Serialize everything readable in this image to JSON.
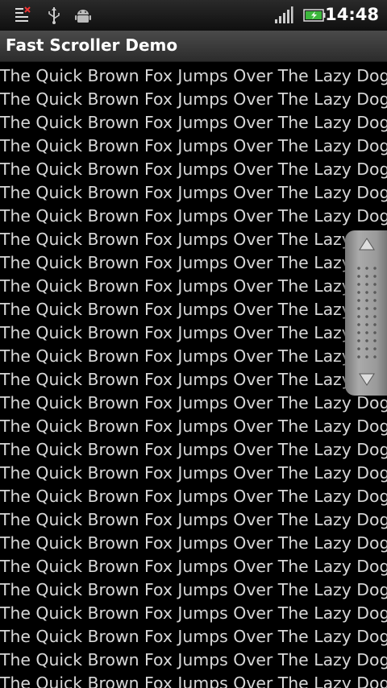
{
  "status_bar": {
    "time": "14:48",
    "icons": [
      "notification-x-icon",
      "usb-icon",
      "android-debug-icon",
      "signal-icon",
      "battery-charging-icon"
    ]
  },
  "app": {
    "title": "Fast Scroller Demo"
  },
  "list": {
    "item_text": "The Quick Brown Fox Jumps Over The Lazy Dog",
    "visible_item_count": 27
  },
  "fast_scroller": {
    "icons": [
      "scroll-up-arrow-icon",
      "scroll-down-arrow-icon",
      "grip-dots-icon"
    ]
  }
}
